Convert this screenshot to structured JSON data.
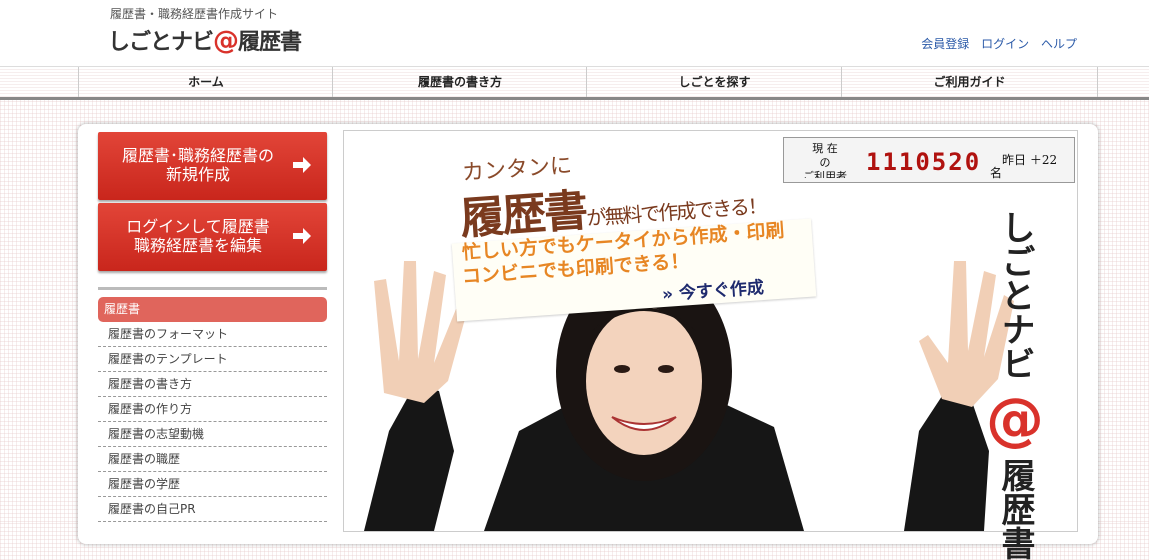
{
  "header": {
    "tagline": "履歴書・職務経歴書作成サイト",
    "logo": {
      "part1": "しごとナビ",
      "at": "@",
      "part2": "履歴書"
    },
    "links": [
      "会員登録",
      "ログイン",
      "ヘルプ"
    ]
  },
  "nav": {
    "items": [
      "ホーム",
      "履歴書の書き方",
      "しごとを探す",
      "ご利用ガイド"
    ]
  },
  "sidebar": {
    "buttons": [
      {
        "line1": "履歴書･職務経歴書の",
        "line2": "新規作成"
      },
      {
        "line1": "ログインして履歴書",
        "line2": "職務経歴書を編集"
      }
    ],
    "menu": {
      "header": "履歴書",
      "items": [
        "履歴書のフォーマット",
        "履歴書のテンプレート",
        "履歴書の書き方",
        "履歴書の作り方",
        "履歴書の志望動機",
        "履歴書の職歴",
        "履歴書の学歴",
        "履歴書の自己PR"
      ]
    }
  },
  "counter": {
    "label_lines": [
      "現 在",
      "の",
      "ご利用者"
    ],
    "value": "1110520",
    "unit": "名",
    "yesterday": "昨日 ＋22"
  },
  "hero": {
    "line1": "カンタンに",
    "line2_big": "履歴書",
    "line2_small": "が無料で作成できる！",
    "line3": "忙しい方でもケータイから作成・印刷",
    "line4": "コンビニでも印刷できる！",
    "cta": "» 今すぐ作成",
    "brand_vertical_top": "しごとナビ",
    "brand_at": "@",
    "brand_vertical_bottom": "履歴書"
  },
  "colors": {
    "accent_red": "#d9322b",
    "link_blue": "#2b5aa8",
    "menu_head": "#e0655c"
  }
}
